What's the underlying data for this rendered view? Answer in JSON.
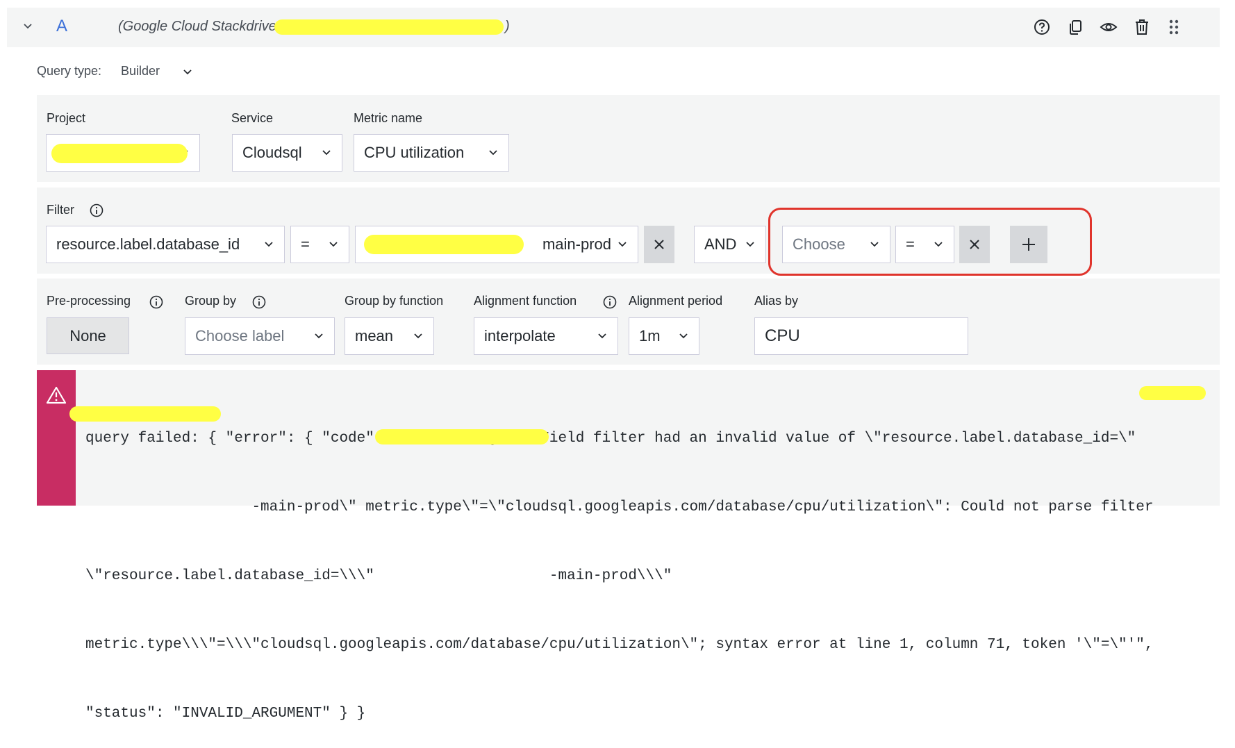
{
  "query_row": {
    "ref_id": "A",
    "datasource_prefix": "(Google Cloud Stackdriver ",
    "datasource_suffix": ")",
    "icons": [
      "help-icon",
      "duplicate-icon",
      "eye-icon",
      "trash-icon",
      "drag-handle-icon"
    ]
  },
  "query_type": {
    "label": "Query type:",
    "value": "Builder"
  },
  "metric_section": {
    "project_label": "Project",
    "service_label": "Service",
    "service_value": "Cloudsql",
    "metric_label": "Metric name",
    "metric_value": "CPU utilization"
  },
  "filter_section": {
    "label": "Filter",
    "filter1_key": "resource.label.database_id",
    "filter1_op": "=",
    "filter1_value_suffix": "main-prod",
    "conjunction": "AND",
    "filter2_key_placeholder": "Choose",
    "filter2_op": "=",
    "remove_symbol": "×",
    "add_symbol": "+"
  },
  "options_section": {
    "preprocessing_label": "Pre-processing",
    "preprocessing_value": "None",
    "group_by_label": "Group by",
    "group_by_placeholder": "Choose label",
    "group_by_function_label": "Group by function",
    "group_by_function_value": "mean",
    "alignment_function_label": "Alignment function",
    "alignment_function_value": "interpolate",
    "alignment_period_label": "Alignment period",
    "alignment_period_value": "1m",
    "alias_label": "Alias by",
    "alias_value": "CPU"
  },
  "error": {
    "lines": [
      "query failed: { \"error\": { \"code\": 400, \"message\": \"Field filter had an invalid value of \\\"resource.label.database_id=\\\"",
      "                   -main-prod\\\" metric.type\\\"=\\\"cloudsql.googleapis.com/database/cpu/utilization\\\": Could not parse filter",
      "\\\"resource.label.database_id=\\\\\\\"                    -main-prod\\\\\\\"",
      "metric.type\\\\\\\"=\\\\\\\"cloudsql.googleapis.com/database/cpu/utilization\\\"; syntax error at line 1, column 71, token '\\\"=\\\"'\",",
      "\"status\": \"INVALID_ARGUMENT\" } }"
    ]
  },
  "colors": {
    "ref_id": "#3d71d9",
    "error_strip": "#c82d63",
    "highlight": "#e0342c",
    "redaction": "#ffff44"
  }
}
